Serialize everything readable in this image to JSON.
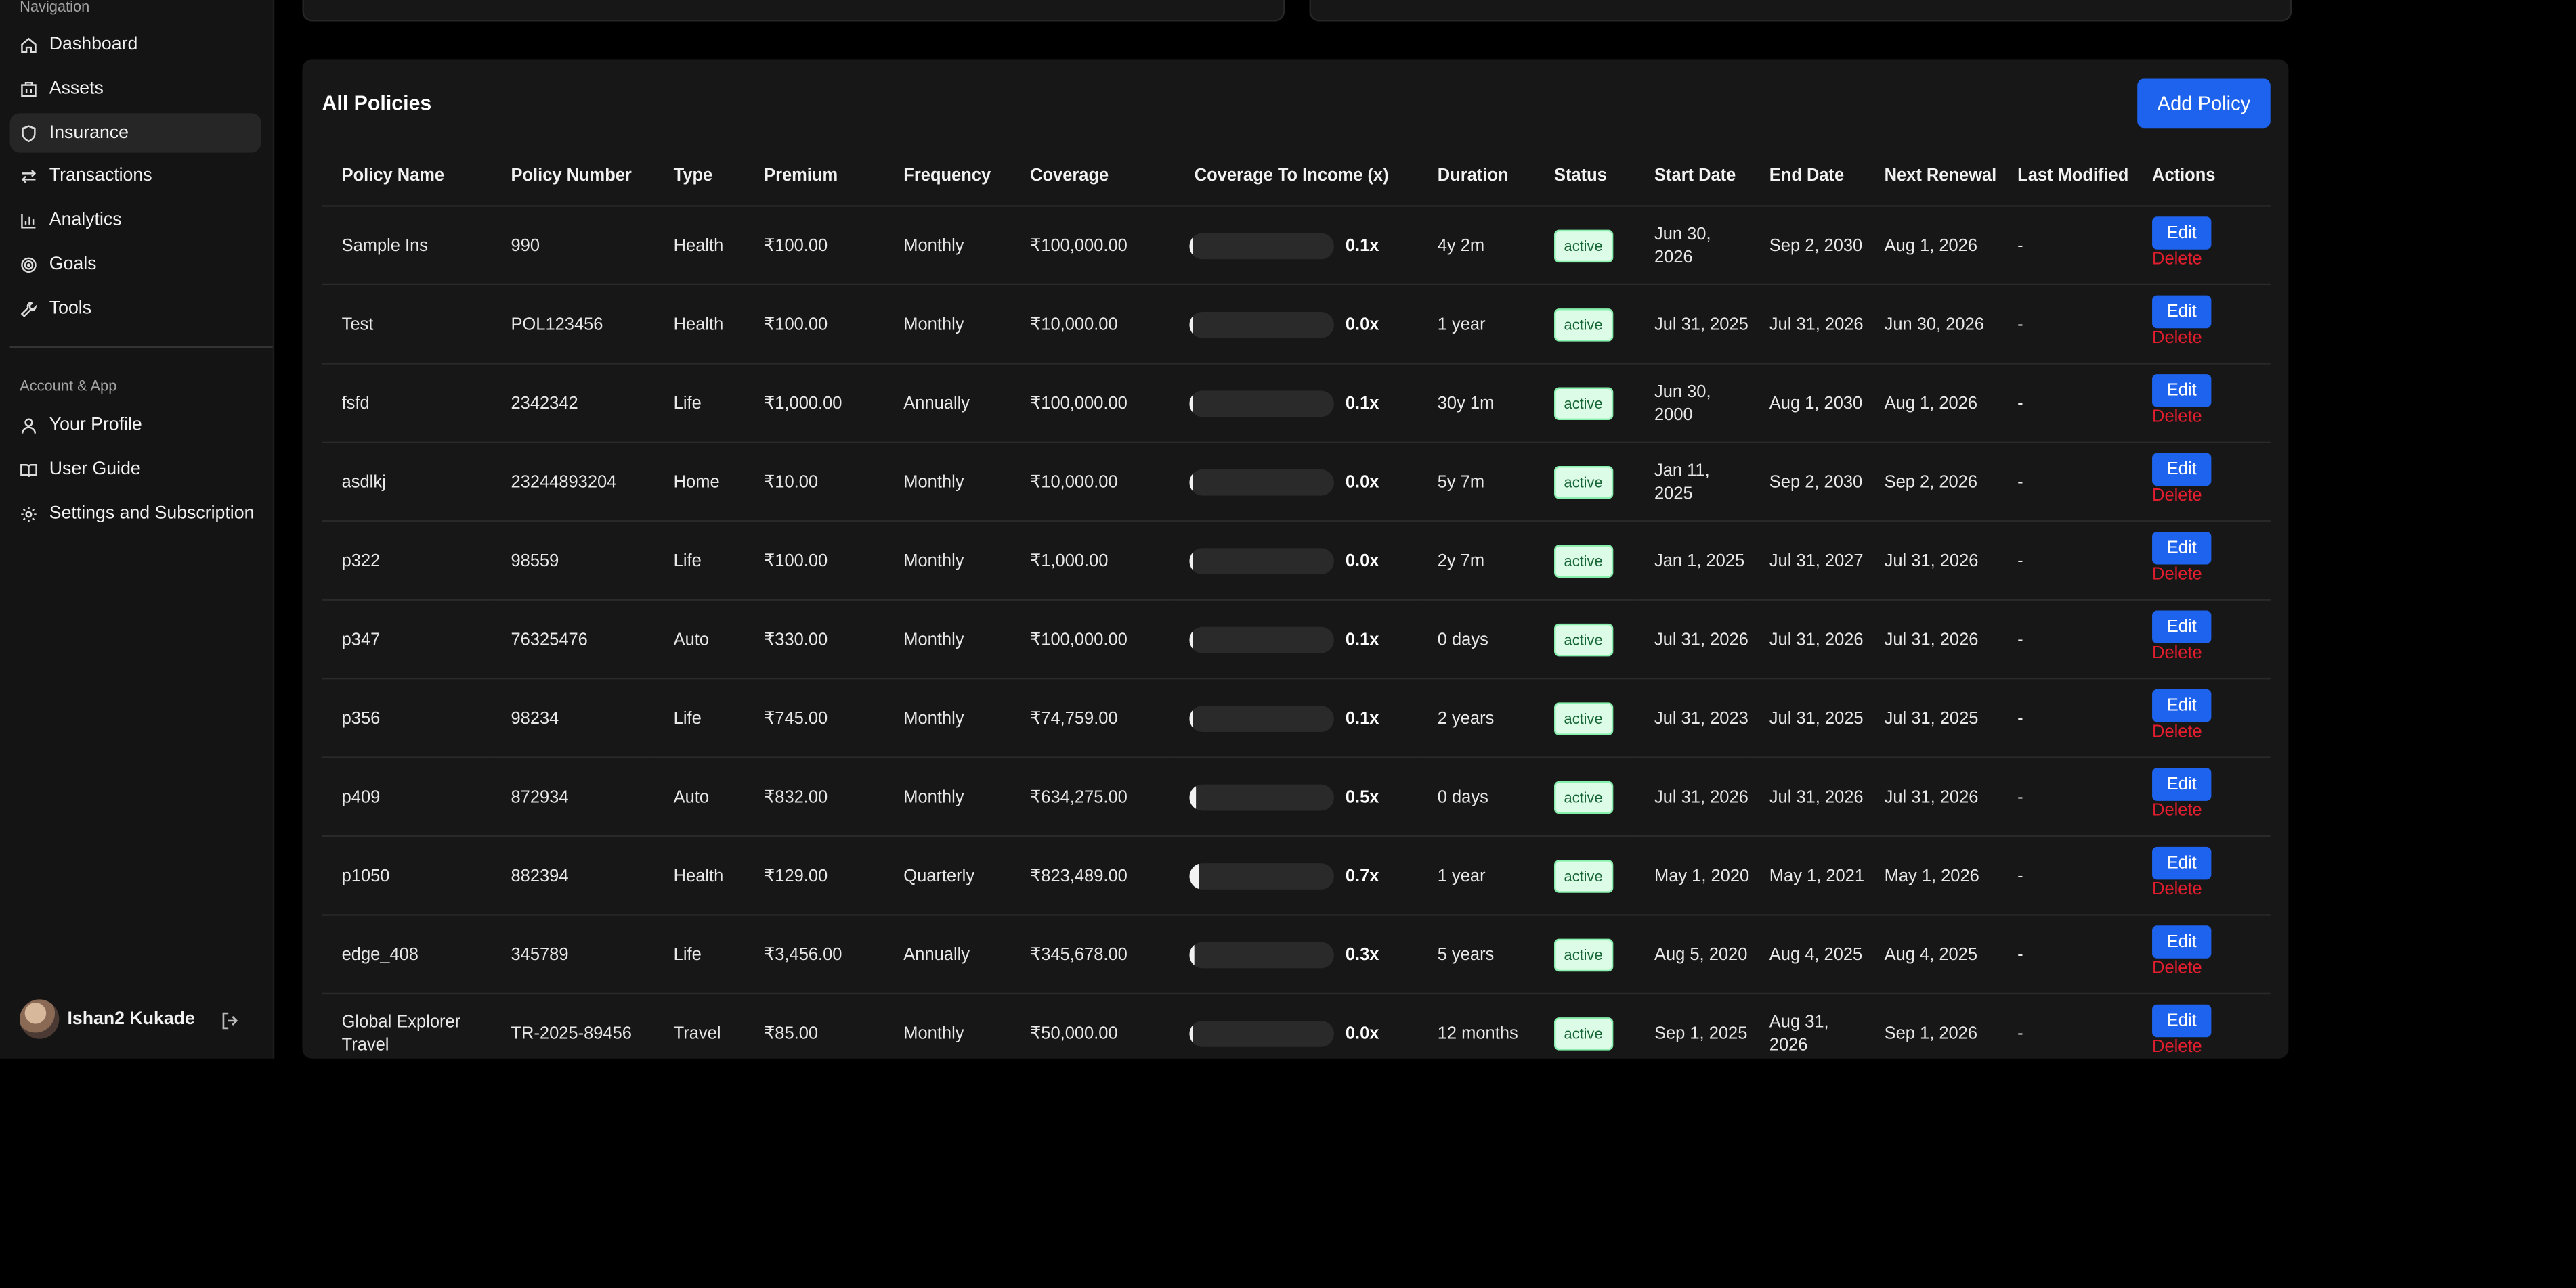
{
  "sidebar": {
    "nav_heading": "Navigation",
    "nav_items": [
      {
        "label": "Dashboard",
        "icon": "home-icon"
      },
      {
        "label": "Assets",
        "icon": "building-icon"
      },
      {
        "label": "Insurance",
        "icon": "shield-icon",
        "active": true
      },
      {
        "label": "Transactions",
        "icon": "arrows-icon"
      },
      {
        "label": "Analytics",
        "icon": "bar-chart-icon"
      },
      {
        "label": "Goals",
        "icon": "target-icon"
      },
      {
        "label": "Tools",
        "icon": "wrench-icon"
      }
    ],
    "account_heading": "Account & App",
    "account_items": [
      {
        "label": "Your Profile",
        "icon": "user-icon"
      },
      {
        "label": "User Guide",
        "icon": "book-icon"
      },
      {
        "label": "Settings and Subscription",
        "icon": "gear-icon"
      }
    ],
    "user": {
      "name": "Ishan2 Kukade"
    }
  },
  "policies": {
    "title": "All Policies",
    "add_label": "Add Policy",
    "edit_label": "Edit",
    "delete_label": "Delete",
    "columns": [
      "Policy Name",
      "Policy Number",
      "Type",
      "Premium",
      "Frequency",
      "Coverage",
      "Coverage To Income (x)",
      "Duration",
      "Status",
      "Start Date",
      "End Date",
      "Next Renewal",
      "Last Modified",
      "Actions"
    ],
    "rows": [
      {
        "name": "Sample Ins",
        "number": "990",
        "type": "Health",
        "premium": "₹100.00",
        "frequency": "Monthly",
        "coverage": "₹100,000.00",
        "ratio": "0.1x",
        "ratio_value": 0.1,
        "duration": "4y 2m",
        "status": "active",
        "start": "Jun 30, 2026",
        "end": "Sep 2, 2030",
        "renewal": "Aug 1, 2026",
        "modified": "-"
      },
      {
        "name": "Test",
        "number": "POL123456",
        "type": "Health",
        "premium": "₹100.00",
        "frequency": "Monthly",
        "coverage": "₹10,000.00",
        "ratio": "0.0x",
        "ratio_value": 0.0,
        "duration": "1 year",
        "status": "active",
        "start": "Jul 31, 2025",
        "end": "Jul 31, 2026",
        "renewal": "Jun 30, 2026",
        "modified": "-"
      },
      {
        "name": "fsfd",
        "number": "2342342",
        "type": "Life",
        "premium": "₹1,000.00",
        "frequency": "Annually",
        "coverage": "₹100,000.00",
        "ratio": "0.1x",
        "ratio_value": 0.1,
        "duration": "30y 1m",
        "status": "active",
        "start": "Jun 30, 2000",
        "end": "Aug 1, 2030",
        "renewal": "Aug 1, 2026",
        "modified": "-"
      },
      {
        "name": "asdlkj",
        "number": "23244893204",
        "type": "Home",
        "premium": "₹10.00",
        "frequency": "Monthly",
        "coverage": "₹10,000.00",
        "ratio": "0.0x",
        "ratio_value": 0.0,
        "duration": "5y 7m",
        "status": "active",
        "start": "Jan 11, 2025",
        "end": "Sep 2, 2030",
        "renewal": "Sep 2, 2026",
        "modified": "-"
      },
      {
        "name": "p322",
        "number": "98559",
        "type": "Life",
        "premium": "₹100.00",
        "frequency": "Monthly",
        "coverage": "₹1,000.00",
        "ratio": "0.0x",
        "ratio_value": 0.0,
        "duration": "2y 7m",
        "status": "active",
        "start": "Jan 1, 2025",
        "end": "Jul 31, 2027",
        "renewal": "Jul 31, 2026",
        "modified": "-"
      },
      {
        "name": "p347",
        "number": "76325476",
        "type": "Auto",
        "premium": "₹330.00",
        "frequency": "Monthly",
        "coverage": "₹100,000.00",
        "ratio": "0.1x",
        "ratio_value": 0.1,
        "duration": "0 days",
        "status": "active",
        "start": "Jul 31, 2026",
        "end": "Jul 31, 2026",
        "renewal": "Jul 31, 2026",
        "modified": "-"
      },
      {
        "name": "p356",
        "number": "98234",
        "type": "Life",
        "premium": "₹745.00",
        "frequency": "Monthly",
        "coverage": "₹74,759.00",
        "ratio": "0.1x",
        "ratio_value": 0.1,
        "duration": "2 years",
        "status": "active",
        "start": "Jul 31, 2023",
        "end": "Jul 31, 2025",
        "renewal": "Jul 31, 2025",
        "modified": "-"
      },
      {
        "name": "p409",
        "number": "872934",
        "type": "Auto",
        "premium": "₹832.00",
        "frequency": "Monthly",
        "coverage": "₹634,275.00",
        "ratio": "0.5x",
        "ratio_value": 0.5,
        "duration": "0 days",
        "status": "active",
        "start": "Jul 31, 2026",
        "end": "Jul 31, 2026",
        "renewal": "Jul 31, 2026",
        "modified": "-"
      },
      {
        "name": "p1050",
        "number": "882394",
        "type": "Health",
        "premium": "₹129.00",
        "frequency": "Quarterly",
        "coverage": "₹823,489.00",
        "ratio": "0.7x",
        "ratio_value": 0.7,
        "duration": "1 year",
        "status": "active",
        "start": "May 1, 2020",
        "end": "May 1, 2021",
        "renewal": "May 1, 2026",
        "modified": "-"
      },
      {
        "name": "edge_408",
        "number": "345789",
        "type": "Life",
        "premium": "₹3,456.00",
        "frequency": "Annually",
        "coverage": "₹345,678.00",
        "ratio": "0.3x",
        "ratio_value": 0.3,
        "duration": "5 years",
        "status": "active",
        "start": "Aug 5, 2020",
        "end": "Aug 4, 2025",
        "renewal": "Aug 4, 2025",
        "modified": "-"
      },
      {
        "name": "Global Explorer Travel",
        "number": "TR-2025-89456",
        "type": "Travel",
        "premium": "₹85.00",
        "frequency": "Monthly",
        "coverage": "₹50,000.00",
        "ratio": "0.0x",
        "ratio_value": 0.0,
        "duration": "12 months",
        "status": "active",
        "start": "Sep 1, 2025",
        "end": "Aug 31, 2026",
        "renewal": "Sep 1, 2026",
        "modified": "-"
      }
    ]
  },
  "colors": {
    "accent": "#1d63ed",
    "delete": "#e11d2e",
    "badge_bg": "#dcfce7",
    "badge_text": "#166534"
  }
}
